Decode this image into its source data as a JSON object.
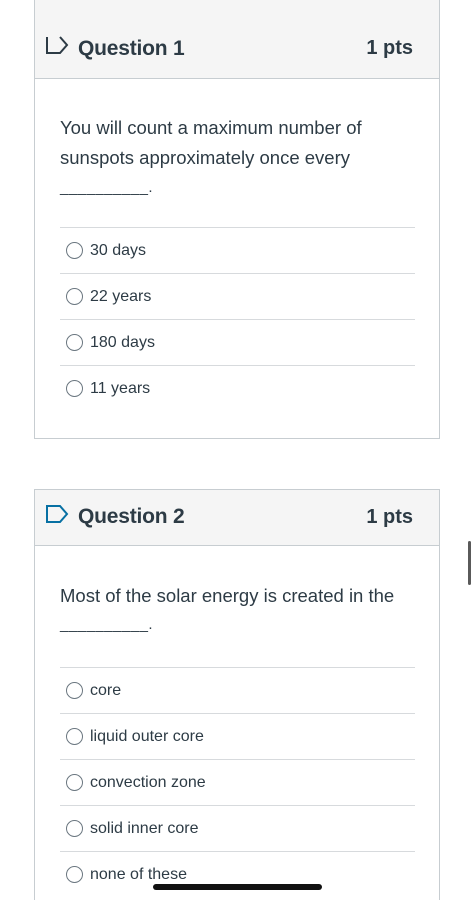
{
  "questions": [
    {
      "title": "Question 1",
      "points": "1 pts",
      "text": "You will count a maximum number of sunspots approximately once every",
      "blank": "__________.",
      "answers": [
        "30 days",
        "22 years",
        "180 days",
        "11 years"
      ]
    },
    {
      "title": "Question 2",
      "points": "1 pts",
      "text": "Most of the solar energy is created in the",
      "blank": "__________.",
      "answers": [
        "core",
        "liquid outer core",
        "convection zone",
        "solid inner core",
        "none of these"
      ]
    }
  ],
  "icons": {
    "flag": "flag-outline-icon",
    "radio": "radio-empty-icon"
  },
  "colors": {
    "text": "#2d3b45",
    "header_bg": "#f5f5f5",
    "border": "#c7cdd1",
    "flag": "#2d3b45",
    "flag_q2": "#0770a3"
  }
}
